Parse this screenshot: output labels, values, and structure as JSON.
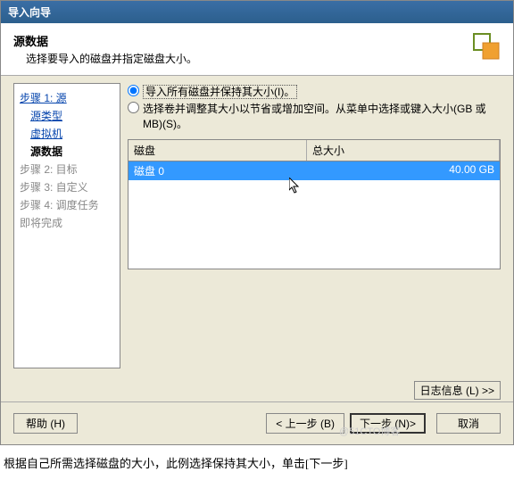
{
  "title": "导入向导",
  "header": {
    "title": "源数据",
    "subtitle": "选择要导入的磁盘并指定磁盘大小。"
  },
  "sidebar": {
    "items": [
      {
        "label": "步骤 1: 源",
        "type": "link"
      },
      {
        "label": "源类型",
        "type": "link",
        "indent": true
      },
      {
        "label": "虚拟机",
        "type": "link",
        "indent": true
      },
      {
        "label": "源数据",
        "type": "bold",
        "indent": true
      },
      {
        "label": "步骤 2: 目标",
        "type": "gray"
      },
      {
        "label": "步骤 3: 自定义",
        "type": "gray"
      },
      {
        "label": "步骤 4: 调度任务",
        "type": "gray"
      },
      {
        "label": "即将完成",
        "type": "gray"
      }
    ]
  },
  "radios": {
    "opt1": "导入所有磁盘并保持其大小(I)。",
    "opt2": "选择卷并调整其大小以节省或增加空间。从菜单中选择或键入大小(GB 或 MB)(S)。"
  },
  "table": {
    "col1": "磁盘",
    "col2": "总大小",
    "row1_col1": "磁盘 0",
    "row1_col2": "40.00 GB"
  },
  "buttons": {
    "log": "日志信息 (L) >>",
    "help": "帮助 (H)",
    "back": "< 上一步 (B)",
    "next": "下一步 (N)>",
    "cancel": "取消"
  },
  "caption": "根据自己所需选择磁盘的大小，此例选择保持其大小，单击[下一步]",
  "watermark": "@51CTO博客"
}
